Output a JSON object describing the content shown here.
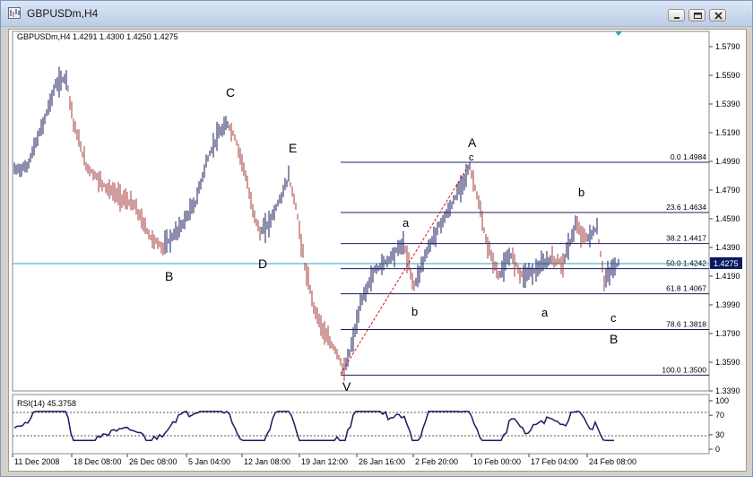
{
  "window": {
    "title": "GBPUSDm,H4",
    "icon": "chart-window-icon",
    "buttons": [
      "minimize-icon",
      "restore-icon",
      "close-icon"
    ]
  },
  "chart_header": "GBPUSDm,H4  1.4291 1.4300 1.4250 1.4275",
  "price_axis": [
    "1.5790",
    "1.5590",
    "1.5390",
    "1.5190",
    "1.4990",
    "1.4790",
    "1.4590",
    "1.4390",
    "1.4190",
    "1.3990",
    "1.3790",
    "1.3590",
    "1.3390"
  ],
  "current_price": "1.4275",
  "time_axis": [
    "11 Dec 2008",
    "18 Dec 08:00",
    "26 Dec 08:00",
    "5 Jan 04:00",
    "12 Jan 08:00",
    "19 Jan 12:00",
    "26 Jan 16:00",
    "2 Feb 20:00",
    "10 Feb 00:00",
    "17 Feb 04:00",
    "24 Feb 08:00"
  ],
  "fibonacci_levels": [
    {
      "label": "0.0 1.4984",
      "price": 1.4984
    },
    {
      "label": "23.6 1.4634",
      "price": 1.4634
    },
    {
      "label": "38.2 1.4417",
      "price": 1.4417
    },
    {
      "label": "50.0 1.4242",
      "price": 1.4242
    },
    {
      "label": "61.8 1.4067",
      "price": 1.4067
    },
    {
      "label": "78.6 1.3818",
      "price": 1.3818
    },
    {
      "label": "100.0 1.3500",
      "price": 1.35
    }
  ],
  "wave_labels": [
    "C",
    "E",
    "B",
    "D",
    "V",
    "A",
    "c",
    "a",
    "b",
    "b",
    "a",
    "c",
    "B"
  ],
  "rsi": {
    "label": "RSI(14) 45.3758",
    "axis": [
      "100",
      "70",
      "30",
      "0"
    ],
    "levels": [
      70,
      30
    ]
  },
  "colors": {
    "background": "#ffffff",
    "bar_up": "#1b1b5e",
    "bar_down": "#a33a3a",
    "fib_line": "#1c1c64",
    "current_price_line": "#2aa7c0",
    "current_price_box": "#0a1a5e",
    "trendline": "#dd1111",
    "rsi_line": "#1b1b5e"
  }
}
